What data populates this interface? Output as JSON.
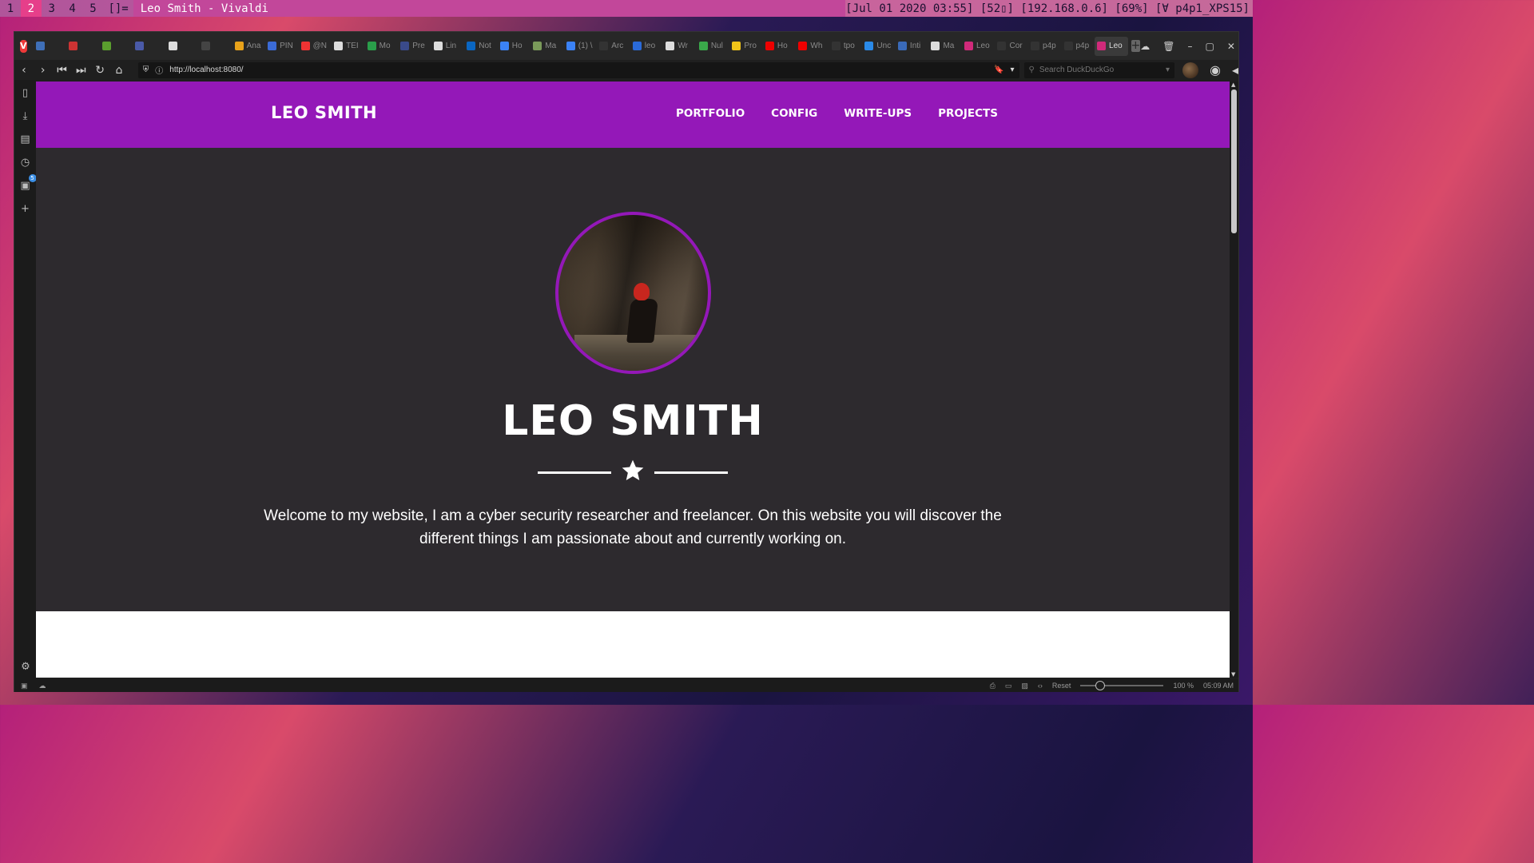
{
  "wm": {
    "workspaces": [
      "1",
      "2",
      "3",
      "4",
      "5"
    ],
    "active_workspace": "2",
    "layout": "[]=",
    "window_title": "Leo Smith - Vivaldi",
    "status": "[Jul 01 2020 03:55] [52▯] [192.168.0.6] [69%] [Ɐ p4p1_XPS15]"
  },
  "browser": {
    "tabs": [
      {
        "label": "",
        "color": "#3f6fb8"
      },
      {
        "label": "",
        "color": "#c33"
      },
      {
        "label": "",
        "color": "#5a9e2e"
      },
      {
        "label": "",
        "color": "#4a5aa8"
      },
      {
        "label": "",
        "color": "#dddddd"
      },
      {
        "label": "",
        "color": "#444"
      },
      {
        "label": "Ana",
        "color": "#e8a21a"
      },
      {
        "label": "PIN",
        "color": "#3b6bd6"
      },
      {
        "label": "@N",
        "color": "#e33"
      },
      {
        "label": "TEI",
        "color": "#ddd"
      },
      {
        "label": "Mo",
        "color": "#2a9e4a"
      },
      {
        "label": "Pre",
        "color": "#3a4a8a"
      },
      {
        "label": "Lin",
        "color": "#ddd"
      },
      {
        "label": "Not",
        "color": "#0a66c2"
      },
      {
        "label": "Ho",
        "color": "#3b82f6"
      },
      {
        "label": "Ma",
        "color": "#7a9a5a"
      },
      {
        "label": "(1) \\",
        "color": "#3b82f6"
      },
      {
        "label": "Arc",
        "color": "#333"
      },
      {
        "label": "leo",
        "color": "#2a6ad8"
      },
      {
        "label": "Wr",
        "color": "#ddd"
      },
      {
        "label": "Nul",
        "color": "#3aa84a"
      },
      {
        "label": "Pro",
        "color": "#f0c419"
      },
      {
        "label": "Ho",
        "color": "#e00"
      },
      {
        "label": "Wh",
        "color": "#e00"
      },
      {
        "label": "tpo",
        "color": "#333"
      },
      {
        "label": "Unc",
        "color": "#2a8ae8"
      },
      {
        "label": "Inti",
        "color": "#3a6ab8"
      },
      {
        "label": "Ma",
        "color": "#ddd"
      },
      {
        "label": "Leo",
        "color": "#d02a7a"
      },
      {
        "label": "Cor",
        "color": "#333"
      },
      {
        "label": "p4p",
        "color": "#333"
      },
      {
        "label": "p4p",
        "color": "#333"
      },
      {
        "label": "Leo",
        "color": "#d02a7a"
      }
    ],
    "active_tab_index": 32,
    "notification_badge": "1",
    "url": "http://localhost:8080/",
    "search_placeholder": "Search DuckDuckGo",
    "sidebar_badge": "5",
    "status": {
      "reset_label": "Reset",
      "zoom": "100 %",
      "zoom_fraction": 0.2,
      "clock": "05:09 AM"
    }
  },
  "site": {
    "brand": "LEO SMITH",
    "nav": [
      "PORTFOLIO",
      "CONFIG",
      "WRITE-UPS",
      "PROJECTS"
    ],
    "hero_title": "LEO SMITH",
    "hero_text": "Welcome to my website, I am a cyber security researcher and freelancer. On this website you will discover the different things I am passionate about and currently working on.",
    "colors": {
      "primary": "#9418b8",
      "hero_bg": "#2d2a2e",
      "text": "#ffffff"
    }
  }
}
